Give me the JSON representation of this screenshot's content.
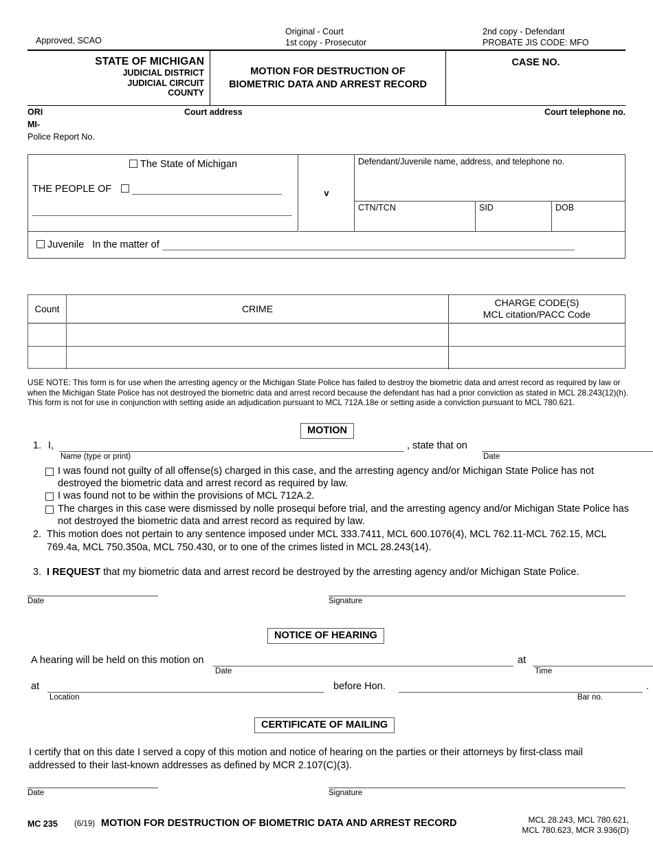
{
  "header": {
    "approved": "Approved, SCAO",
    "copy_mid_line1": "Original - Court",
    "copy_mid_line2": "1st copy - Prosecutor",
    "copy_right_line1": "2nd copy - Defendant",
    "copy_right_line2": "PROBATE JIS CODE: MFO",
    "state": "STATE OF MICHIGAN",
    "judicial_district": "JUDICIAL DISTRICT",
    "judicial_circuit": "JUDICIAL CIRCUIT",
    "county": "COUNTY",
    "form_title_line1": "MOTION FOR DESTRUCTION OF",
    "form_title_line2": "BIOMETRIC DATA AND ARREST RECORD",
    "case_no": "CASE NO."
  },
  "ori_row": {
    "ori": "ORI",
    "court_address": "Court address",
    "court_telephone": "Court telephone no.",
    "mi_prefix": "MI-",
    "police_report_no": "Police Report No."
  },
  "parties": {
    "state_of_michigan": "The State of Michigan",
    "the_people_of": "THE PEOPLE OF",
    "v": "v",
    "defendant_box_label": "Defendant/Juvenile name, address, and telephone no.",
    "ctn_tcn": "CTN/TCN",
    "sid": "SID",
    "dob": "DOB",
    "juvenile": "Juvenile",
    "in_the_matter_of": "In the matter of"
  },
  "crime_table": {
    "col_count": "Count",
    "col_crime": "CRIME",
    "col_charge_line1": "CHARGE CODE(S)",
    "col_charge_line2": "MCL citation/PACC Code",
    "rows": [
      {
        "count": "",
        "crime": "",
        "charge": ""
      },
      {
        "count": "",
        "crime": "",
        "charge": ""
      }
    ]
  },
  "use_note": "USE NOTE: This form is for use when the arresting agency or the Michigan State Police has failed to destroy the biometric data and arrest record as required by law or when the Michigan State Police has not destroyed the biometric data and arrest record because the defendant has had a prior conviction as stated in MCL 28.243(12)(h). This form is not for use in conjunction with setting aside an adjudication pursuant to MCL 712A.18e or setting aside a conviction pursuant to MCL 780.621.",
  "motion": {
    "heading": "MOTION",
    "item1_number": "1.",
    "item1_lead": "I,",
    "item1_name_label": "Name (type or print)",
    "item1_mid": ", state that on",
    "item1_date_label": "Date",
    "options": [
      "I was found not guilty of all offense(s) charged in this case, and the arresting agency and/or Michigan State Police has not destroyed the biometric data and arrest record as required by law.",
      "I was found not to be within the provisions of MCL 712A.2.",
      "The charges in this case were dismissed by nolle prosequi before trial, and the arresting agency and/or Michigan State Police has not destroyed the biometric data and arrest record as required by law."
    ],
    "item2_number": "2.",
    "item2_text": "This motion does not pertain to any sentence imposed under MCL 333.7411, MCL 600.1076(4), MCL 762.11-MCL 762.15, MCL 769.4a, MCL 750.350a, MCL 750.430, or to one of the crimes listed in MCL 28.243(14).",
    "item3_number": "3.",
    "item3_bold": "I REQUEST",
    "item3_text": "that my biometric data and arrest record be destroyed by the arresting agency and/or Michigan State Police.",
    "date_label": "Date",
    "signature_label": "Signature"
  },
  "notice_of_hearing": {
    "heading": "NOTICE OF HEARING",
    "lead": "A hearing will be held on this motion on",
    "date_label": "Date",
    "at1": "at",
    "time_label": "Time",
    "at2": "at",
    "location_label": "Location",
    "before_hon": "before Hon.",
    "bar_no_label": "Bar no.",
    "period": "."
  },
  "certificate_of_mailing": {
    "heading": "CERTIFICATE OF MAILING",
    "text": "I certify that on this date I served a copy of this motion and notice of hearing on the parties or their attorneys by first-class mail addressed to their last-known addresses as defined by MCR 2.107(C)(3).",
    "date_label": "Date",
    "signature_label": "Signature"
  },
  "footer": {
    "form_number": "MC 235",
    "revision": "(6/19)",
    "title": "MOTION FOR DESTRUCTION OF BIOMETRIC DATA AND ARREST RECORD",
    "citation_line1": "MCL 28.243, MCL 780.621,",
    "citation_line2": "MCL 780.623, MCR 3.936(D)"
  }
}
